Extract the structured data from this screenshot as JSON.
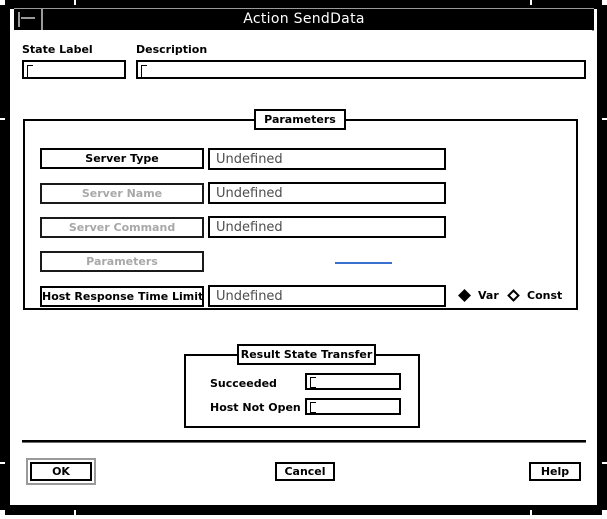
{
  "window": {
    "title": "Action SendData",
    "menu_button_icon": "window-menu-icon"
  },
  "header": {
    "state_label": {
      "label": "State Label",
      "value": "",
      "placeholder": ""
    },
    "description": {
      "label": "Description",
      "value": "",
      "placeholder": ""
    }
  },
  "parameters_group": {
    "title": "Parameters",
    "rows": [
      {
        "name": "Server Type",
        "value": "Undefined",
        "enabled": true,
        "has_value_field": true
      },
      {
        "name": "Server Name",
        "value": "Undefined",
        "enabled": false,
        "has_value_field": true
      },
      {
        "name": "Server Command",
        "value": "Undefined",
        "enabled": false,
        "has_value_field": true
      },
      {
        "name": "Parameters",
        "value": "",
        "enabled": false,
        "has_value_field": false
      },
      {
        "name": "Host Response Time Limit",
        "value": "Undefined",
        "enabled": true,
        "has_value_field": true
      }
    ],
    "value_type": {
      "selected": "Var",
      "options": [
        {
          "label": "Var",
          "selected": true
        },
        {
          "label": "Const",
          "selected": false
        }
      ]
    }
  },
  "result_state_transfer": {
    "title": "Result State Transfer",
    "rows": [
      {
        "label": "Succeeded",
        "value": ""
      },
      {
        "label": "Host Not Open",
        "value": ""
      }
    ]
  },
  "actions": {
    "ok": "OK",
    "cancel": "Cancel",
    "help": "Help"
  },
  "colors": {
    "titlebar_bg": "#000000",
    "titlebar_fg": "#ffffff",
    "dialog_bg": "#ffffff",
    "border": "#000000",
    "disabled_text": "#b4b4b4",
    "value_text": "#4d4d4d",
    "default_ring": "#9a9a9a"
  }
}
